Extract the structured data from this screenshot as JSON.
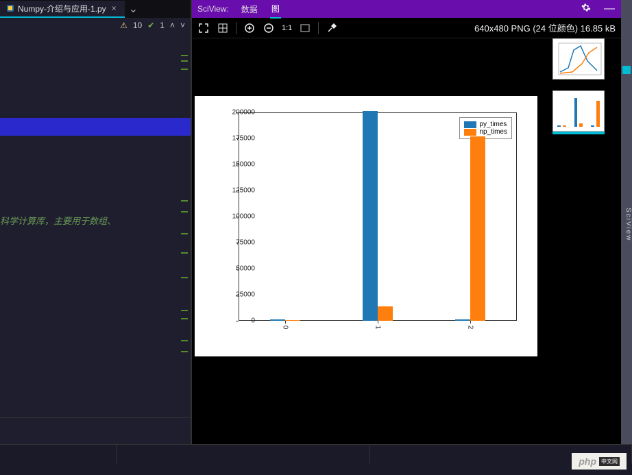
{
  "tab": {
    "filename": "Numpy-介绍与应用-1.py"
  },
  "status": {
    "warn_count": "10",
    "check_count": "1"
  },
  "comment_line": "科学计算库，主要用于数组、",
  "sciview": {
    "title": "SciView:",
    "tabs": {
      "data": "数据",
      "image": "图"
    },
    "side_label": "SciView"
  },
  "image_info": "640x480 PNG (24 位颜色) 16.85 kB",
  "toolbar": {
    "ratio": "1:1"
  },
  "chart_data": {
    "type": "bar",
    "categories": [
      "0",
      "1",
      "2"
    ],
    "series": [
      {
        "name": "py_times",
        "values": [
          1000,
          201000,
          1000
        ]
      },
      {
        "name": "np_times",
        "values": [
          600,
          14000,
          177000
        ]
      }
    ],
    "ylim": [
      0,
      200000
    ],
    "yticks": [
      0,
      25000,
      50000,
      75000,
      100000,
      125000,
      150000,
      175000,
      200000
    ],
    "title": "",
    "xlabel": "",
    "ylabel": ""
  },
  "watermark": {
    "brand": "php",
    "suffix": "中文网"
  }
}
